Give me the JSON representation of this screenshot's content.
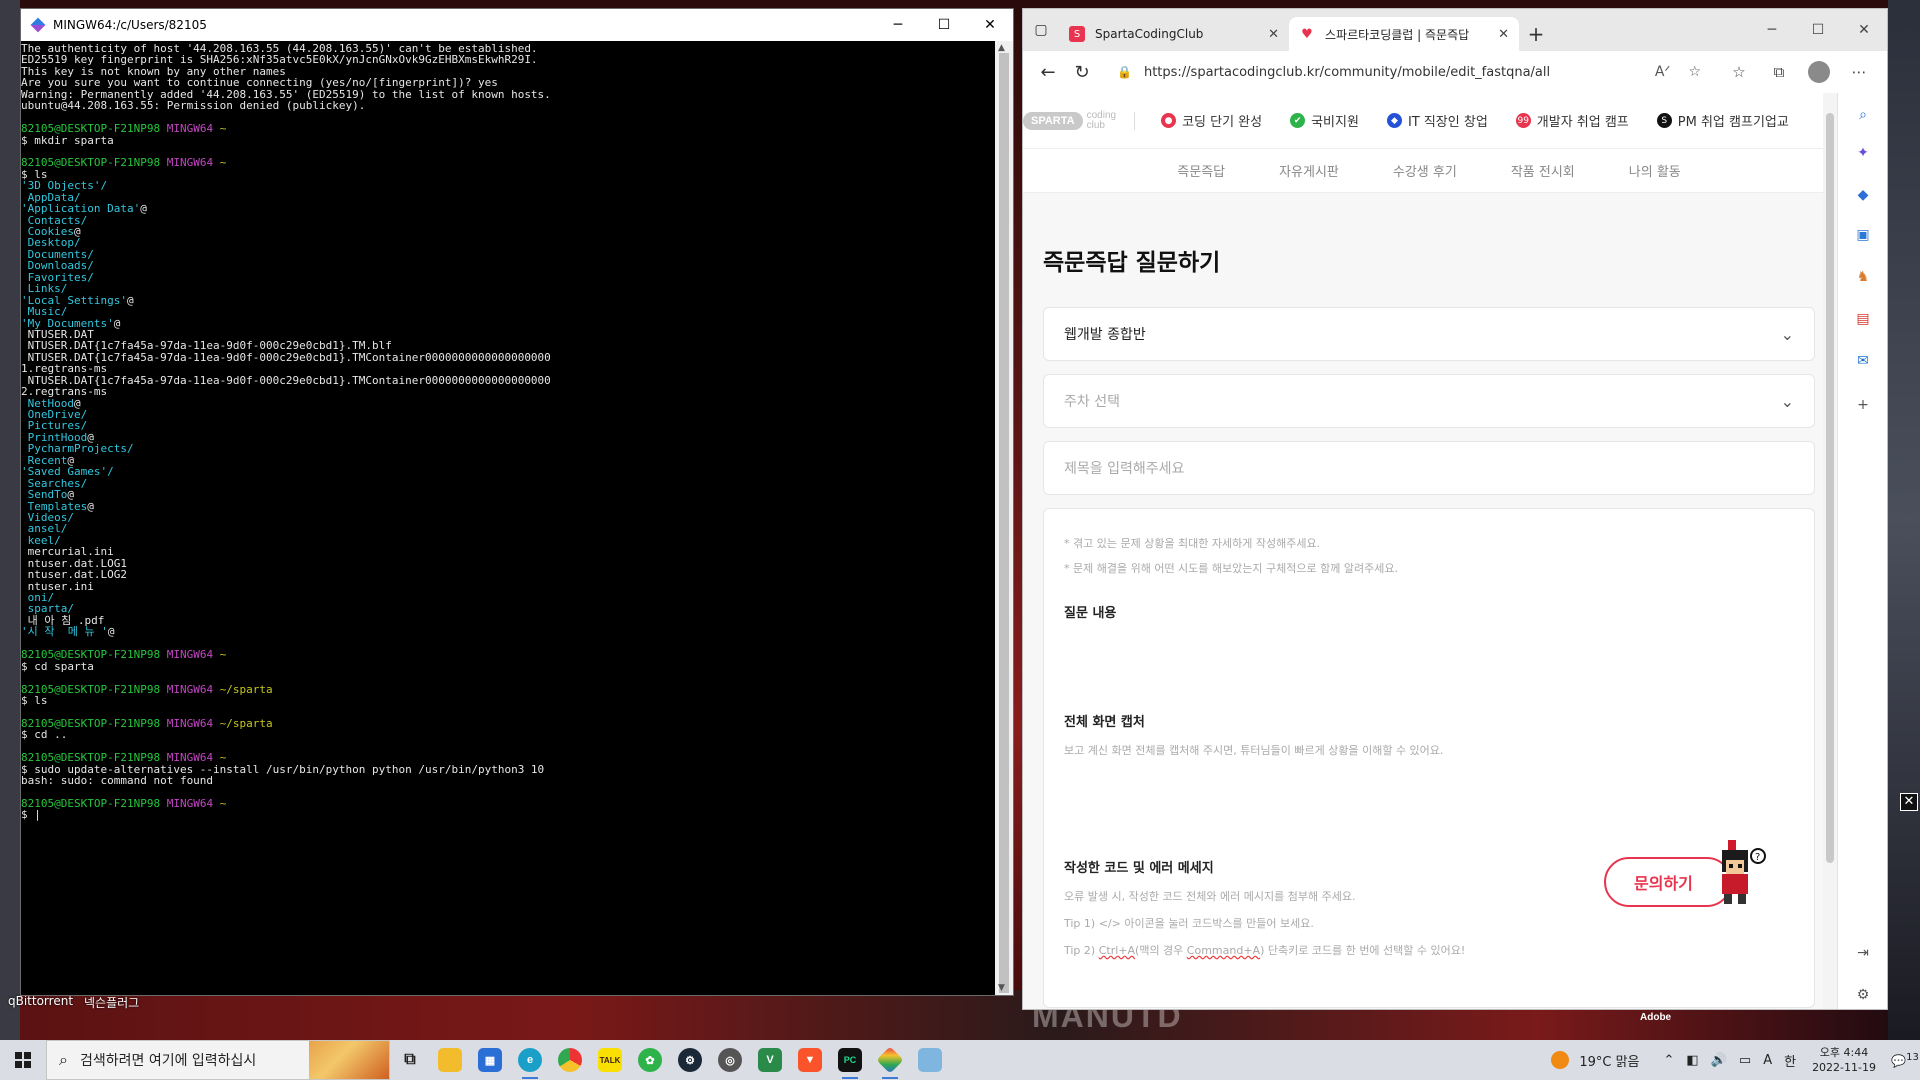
{
  "desktop": {
    "labels": [
      "qBittorrent",
      "넥슨플러그"
    ],
    "wallpaper_text": "MANUTD",
    "adobe": "Adobe"
  },
  "terminal": {
    "title": "MINGW64:/c/Users/82105",
    "lines": [
      [
        {
          "c": "w",
          "t": "The authenticity of host '44.208.163.55 (44.208.163.55)' can't be established."
        }
      ],
      [
        {
          "c": "w",
          "t": "ED25519 key fingerprint is SHA256:xNf35atvc5E0kX/ynJcnGNxOvk9GzEHBXmsEkwhR29I."
        }
      ],
      [
        {
          "c": "w",
          "t": "This key is not known by any other names"
        }
      ],
      [
        {
          "c": "w",
          "t": "Are you sure you want to continue connecting (yes/no/[fingerprint])? yes"
        }
      ],
      [
        {
          "c": "w",
          "t": "Warning: Permanently added '44.208.163.55' (ED25519) to the list of known hosts."
        }
      ],
      [
        {
          "c": "w",
          "t": "ubuntu@44.208.163.55: Permission denied (publickey)."
        }
      ],
      [
        {
          "c": "w",
          "t": ""
        }
      ],
      [
        {
          "c": "g",
          "t": "82105@DESKTOP-F21NP98 "
        },
        {
          "c": "m",
          "t": "MINGW64 "
        },
        {
          "c": "y",
          "t": "~"
        }
      ],
      [
        {
          "c": "w",
          "t": "$ mkdir sparta"
        }
      ],
      [
        {
          "c": "w",
          "t": ""
        }
      ],
      [
        {
          "c": "g",
          "t": "82105@DESKTOP-F21NP98 "
        },
        {
          "c": "m",
          "t": "MINGW64 "
        },
        {
          "c": "y",
          "t": "~"
        }
      ],
      [
        {
          "c": "w",
          "t": "$ ls"
        }
      ],
      [
        {
          "c": "c",
          "t": "'3D Objects'/"
        }
      ],
      [
        {
          "c": "c",
          "t": " AppData/"
        }
      ],
      [
        {
          "c": "c",
          "t": "'Application Data'"
        },
        {
          "c": "w",
          "t": "@"
        }
      ],
      [
        {
          "c": "c",
          "t": " Contacts/"
        }
      ],
      [
        {
          "c": "c",
          "t": " Cookies"
        },
        {
          "c": "w",
          "t": "@"
        }
      ],
      [
        {
          "c": "c",
          "t": " Desktop/"
        }
      ],
      [
        {
          "c": "c",
          "t": " Documents/"
        }
      ],
      [
        {
          "c": "c",
          "t": " Downloads/"
        }
      ],
      [
        {
          "c": "c",
          "t": " Favorites/"
        }
      ],
      [
        {
          "c": "c",
          "t": " Links/"
        }
      ],
      [
        {
          "c": "c",
          "t": "'Local Settings'"
        },
        {
          "c": "w",
          "t": "@"
        }
      ],
      [
        {
          "c": "c",
          "t": " Music/"
        }
      ],
      [
        {
          "c": "c",
          "t": "'My Documents'"
        },
        {
          "c": "w",
          "t": "@"
        }
      ],
      [
        {
          "c": "w",
          "t": " NTUSER.DAT"
        }
      ],
      [
        {
          "c": "w",
          "t": " NTUSER.DAT{1c7fa45a-97da-11ea-9d0f-000c29e0cbd1}.TM.blf"
        }
      ],
      [
        {
          "c": "w",
          "t": " NTUSER.DAT{1c7fa45a-97da-11ea-9d0f-000c29e0cbd1}.TMContainer0000000000000000000"
        }
      ],
      [
        {
          "c": "w",
          "t": "1.regtrans-ms"
        }
      ],
      [
        {
          "c": "w",
          "t": " NTUSER.DAT{1c7fa45a-97da-11ea-9d0f-000c29e0cbd1}.TMContainer0000000000000000000"
        }
      ],
      [
        {
          "c": "w",
          "t": "2.regtrans-ms"
        }
      ],
      [
        {
          "c": "c",
          "t": " NetHood"
        },
        {
          "c": "w",
          "t": "@"
        }
      ],
      [
        {
          "c": "c",
          "t": " OneDrive/"
        }
      ],
      [
        {
          "c": "c",
          "t": " Pictures/"
        }
      ],
      [
        {
          "c": "c",
          "t": " PrintHood"
        },
        {
          "c": "w",
          "t": "@"
        }
      ],
      [
        {
          "c": "c",
          "t": " PycharmProjects/"
        }
      ],
      [
        {
          "c": "c",
          "t": " Recent"
        },
        {
          "c": "w",
          "t": "@"
        }
      ],
      [
        {
          "c": "c",
          "t": "'Saved Games'/"
        }
      ],
      [
        {
          "c": "c",
          "t": " Searches/"
        }
      ],
      [
        {
          "c": "c",
          "t": " SendTo"
        },
        {
          "c": "w",
          "t": "@"
        }
      ],
      [
        {
          "c": "c",
          "t": " Templates"
        },
        {
          "c": "w",
          "t": "@"
        }
      ],
      [
        {
          "c": "c",
          "t": " Videos/"
        }
      ],
      [
        {
          "c": "c",
          "t": " ansel/"
        }
      ],
      [
        {
          "c": "c",
          "t": " keel/"
        }
      ],
      [
        {
          "c": "w",
          "t": " mercurial.ini"
        }
      ],
      [
        {
          "c": "w",
          "t": " ntuser.dat.LOG1"
        }
      ],
      [
        {
          "c": "w",
          "t": " ntuser.dat.LOG2"
        }
      ],
      [
        {
          "c": "w",
          "t": " ntuser.ini"
        }
      ],
      [
        {
          "c": "c",
          "t": " oni/"
        }
      ],
      [
        {
          "c": "c",
          "t": " sparta/"
        }
      ],
      [
        {
          "c": "w",
          "t": " 내 아 침 .pdf"
        }
      ],
      [
        {
          "c": "c",
          "t": "'시 작  메 뉴 '"
        },
        {
          "c": "w",
          "t": "@"
        }
      ],
      [
        {
          "c": "w",
          "t": ""
        }
      ],
      [
        {
          "c": "g",
          "t": "82105@DESKTOP-F21NP98 "
        },
        {
          "c": "m",
          "t": "MINGW64 "
        },
        {
          "c": "y",
          "t": "~"
        }
      ],
      [
        {
          "c": "w",
          "t": "$ cd sparta"
        }
      ],
      [
        {
          "c": "w",
          "t": ""
        }
      ],
      [
        {
          "c": "g",
          "t": "82105@DESKTOP-F21NP98 "
        },
        {
          "c": "m",
          "t": "MINGW64 "
        },
        {
          "c": "y",
          "t": "~/sparta"
        }
      ],
      [
        {
          "c": "w",
          "t": "$ ls"
        }
      ],
      [
        {
          "c": "w",
          "t": ""
        }
      ],
      [
        {
          "c": "g",
          "t": "82105@DESKTOP-F21NP98 "
        },
        {
          "c": "m",
          "t": "MINGW64 "
        },
        {
          "c": "y",
          "t": "~/sparta"
        }
      ],
      [
        {
          "c": "w",
          "t": "$ cd .."
        }
      ],
      [
        {
          "c": "w",
          "t": ""
        }
      ],
      [
        {
          "c": "g",
          "t": "82105@DESKTOP-F21NP98 "
        },
        {
          "c": "m",
          "t": "MINGW64 "
        },
        {
          "c": "y",
          "t": "~"
        }
      ],
      [
        {
          "c": "w",
          "t": "$ sudo update-alternatives --install /usr/bin/python python /usr/bin/python3 10"
        }
      ],
      [
        {
          "c": "w",
          "t": "bash: sudo: command not found"
        }
      ],
      [
        {
          "c": "w",
          "t": ""
        }
      ],
      [
        {
          "c": "g",
          "t": "82105@DESKTOP-F21NP98 "
        },
        {
          "c": "m",
          "t": "MINGW64 "
        },
        {
          "c": "y",
          "t": "~"
        }
      ],
      [
        {
          "c": "w",
          "t": "$ |"
        }
      ]
    ]
  },
  "browser": {
    "tabs": [
      {
        "label": "SpartaCodingClub",
        "active": false
      },
      {
        "label": "스파르타코딩클럽 | 즉문즉답",
        "active": true
      }
    ],
    "url": "https://spartacodingclub.kr/community/mobile/edit_fastqna/all",
    "site": {
      "logo_badge": "SPARTA",
      "logo_text1": "coding",
      "logo_text2": "club",
      "nav": [
        {
          "label": "코딩 단기 완성",
          "color": "#e8344e",
          "icon": "●"
        },
        {
          "label": "국비지원",
          "color": "#2db34a",
          "icon": "✔"
        },
        {
          "label": "IT 직장인 창업",
          "color": "#2451d6",
          "icon": "◆"
        },
        {
          "label": "개발자 취업 캠프",
          "color": "#e8344e",
          "icon": "99"
        },
        {
          "label": "PM 취업 캠프",
          "color": "#111111",
          "icon": "S"
        },
        {
          "label": "기업교",
          "color": "#ffffff",
          "icon": ""
        }
      ],
      "subnav": [
        "즉문즉답",
        "자유게시판",
        "수강생 후기",
        "작품 전시회",
        "나의 활동"
      ],
      "page_title": "즉문즉답 질문하기",
      "course_select": "웹개발 종합반",
      "week_select_placeholder": "주차 선택",
      "title_placeholder": "제목을 입력해주세요",
      "hint1": "* 겪고 있는 문제 상황을 최대한 자세하게 작성해주세요.",
      "hint2": "* 문제 해결을 위해 어떤 시도를 해보았는지 구체적으로 함께 알려주세요.",
      "sec1_title": "질문 내용",
      "sec2_title": "전체 화면 캡처",
      "sec2_desc": "보고 계신 화면 전체를 캡처해 주시면, 튜터님들이 빠르게 상황을 이해할 수 있어요.",
      "sec3_title": "작성한 코드 및 에러 메세지",
      "sec3_desc1": "오류 발생 시, 작성한 코드 전체와 에러 메시지를 첨부해 주세요.",
      "sec3_desc2": "Tip 1) </> 아이콘을 눌러 코드박스를 만들어 보세요.",
      "sec3_desc3_pre": "Tip 2) ",
      "sec3_desc3_u1": "Ctrl+A",
      "sec3_desc3_mid": "(맥의 경우 ",
      "sec3_desc3_u2": "Command+A",
      "sec3_desc3_post": ") 단축키로 코드를 한 번에 선택할 수 있어요!",
      "ask_button": "문의하기"
    }
  },
  "taskbar": {
    "search_placeholder": "검색하려면 여기에 입력하십시",
    "weather": "19°C 맑음",
    "time": "오후 4:44",
    "date": "2022-11-19",
    "notif_count": "13",
    "ime": "A",
    "ime2": "한"
  }
}
